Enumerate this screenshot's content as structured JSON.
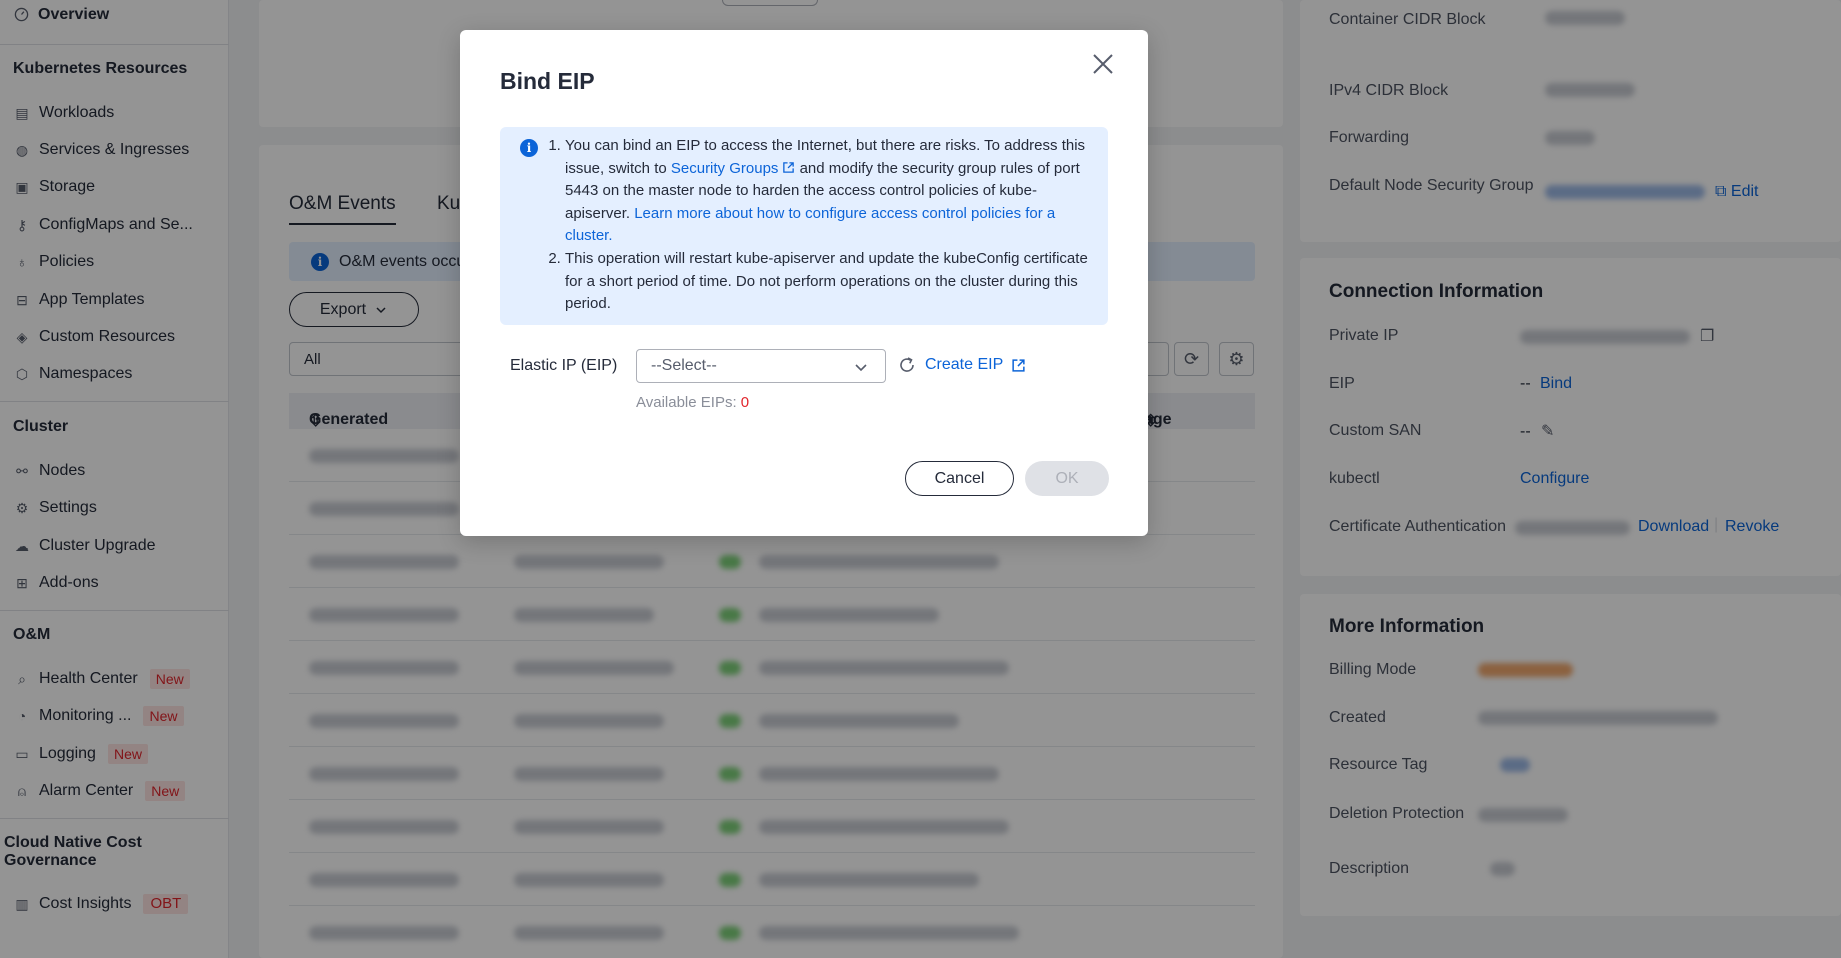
{
  "sidebar": {
    "overview": "Overview",
    "section_k8s": "Kubernetes Resources",
    "k8s_items": [
      "Workloads",
      "Services & Ingresses",
      "Storage",
      "ConfigMaps and Se...",
      "Policies",
      "App Templates",
      "Custom Resources",
      "Namespaces"
    ],
    "section_cluster": "Cluster",
    "cluster_items": [
      "Nodes",
      "Settings",
      "Cluster Upgrade",
      "Add-ons"
    ],
    "section_om": "O&M",
    "om_items": [
      "Health Center",
      "Monitoring ...",
      "Logging",
      "Alarm Center"
    ],
    "om_badge": "New",
    "section_cost": "Cloud Native Cost Governance",
    "cost_items": [
      "Cost Insights"
    ],
    "cost_badge": "OBT"
  },
  "main": {
    "tabs": [
      "O&M Events",
      "Ku"
    ],
    "info_text": "O&M events occu",
    "export_label": "Export",
    "filter_value": "All",
    "col_generated": "Generated",
    "col_message": "age"
  },
  "right": {
    "cluster_info": {
      "labels": [
        "Container CIDR Block",
        "IPv4 CIDR Block",
        "Forwarding",
        "Default Node Security Group"
      ],
      "edit": "Edit"
    },
    "connection": {
      "title": "Connection Information",
      "labels": [
        "Private IP",
        "EIP",
        "Custom SAN",
        "kubectl",
        "Certificate Authentication"
      ],
      "eip_value": "--",
      "eip_bind": "Bind",
      "san_value": "--",
      "kubectl_configure": "Configure",
      "cert_download": "Download",
      "cert_revoke": "Revoke"
    },
    "more": {
      "title": "More Information",
      "labels": [
        "Billing Mode",
        "Created",
        "Resource Tag",
        "Deletion Protection",
        "Description"
      ]
    }
  },
  "modal": {
    "title": "Bind EIP",
    "notice_1_a": "You can bind an EIP to access the Internet, but there are risks. To address this issue, switch to ",
    "notice_1_link": "Security Groups",
    "notice_1_b": " and modify the security group rules of port 5443 on the master node to harden the access control policies of kube-apiserver. ",
    "notice_1_link2": "Learn more about how to configure access control policies for a cluster.",
    "notice_2": "This operation will restart kube-apiserver and update the kubeConfig certificate for a short period of time. Do not perform operations on the cluster during this period.",
    "field_label": "Elastic IP (EIP)",
    "select_placeholder": "--Select--",
    "create_eip": "Create EIP",
    "available_label": "Available EIPs: ",
    "available_count": "0",
    "cancel": "Cancel",
    "ok": "OK"
  },
  "colors": {
    "accent": "#0c64d8",
    "danger": "#e1252c",
    "notice_bg": "#e4efff"
  }
}
